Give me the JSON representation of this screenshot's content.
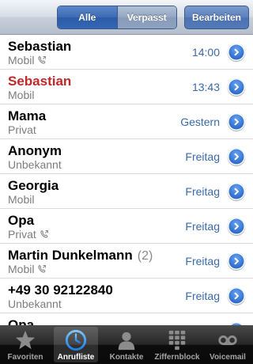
{
  "navbar": {
    "segments": [
      "Alle",
      "Verpasst"
    ],
    "edit_label": "Bearbeiten"
  },
  "calls": [
    {
      "name": "Sebastian",
      "count": "",
      "type": "Mobil",
      "outgoing": true,
      "time": "14:00",
      "missed": false
    },
    {
      "name": "Sebastian",
      "count": "",
      "type": "Mobil",
      "outgoing": false,
      "time": "13:43",
      "missed": true
    },
    {
      "name": "Mama",
      "count": "",
      "type": "Privat",
      "outgoing": false,
      "time": "Gestern",
      "missed": false
    },
    {
      "name": "Anonym",
      "count": "",
      "type": "Unbekannt",
      "outgoing": false,
      "time": "Freitag",
      "missed": false
    },
    {
      "name": "Georgia",
      "count": "",
      "type": "Mobil",
      "outgoing": false,
      "time": "Freitag",
      "missed": false
    },
    {
      "name": "Opa",
      "count": "",
      "type": "Privat",
      "outgoing": true,
      "time": "Freitag",
      "missed": false
    },
    {
      "name": "Martin Dunkelmann",
      "count": "(2)",
      "type": "Mobil",
      "outgoing": true,
      "time": "Freitag",
      "missed": false
    },
    {
      "name": "+49 30 92122840",
      "count": "",
      "type": "Unbekannt",
      "outgoing": false,
      "time": "Freitag",
      "missed": false
    },
    {
      "name": "Opa",
      "count": "",
      "type": "",
      "outgoing": false,
      "time": "",
      "missed": false
    }
  ],
  "tabs": [
    {
      "label": "Favoriten",
      "icon": "star-icon",
      "selected": false
    },
    {
      "label": "Anrufliste",
      "icon": "clock-icon",
      "selected": true
    },
    {
      "label": "Kontakte",
      "icon": "contacts-icon",
      "selected": false
    },
    {
      "label": "Ziffernblock",
      "icon": "keypad-icon",
      "selected": false
    },
    {
      "label": "Voicemail",
      "icon": "voicemail-icon",
      "selected": false
    }
  ],
  "colors": {
    "missed": "#c0282a",
    "time": "#3a6aa8",
    "accent": "#2f6fd0"
  }
}
